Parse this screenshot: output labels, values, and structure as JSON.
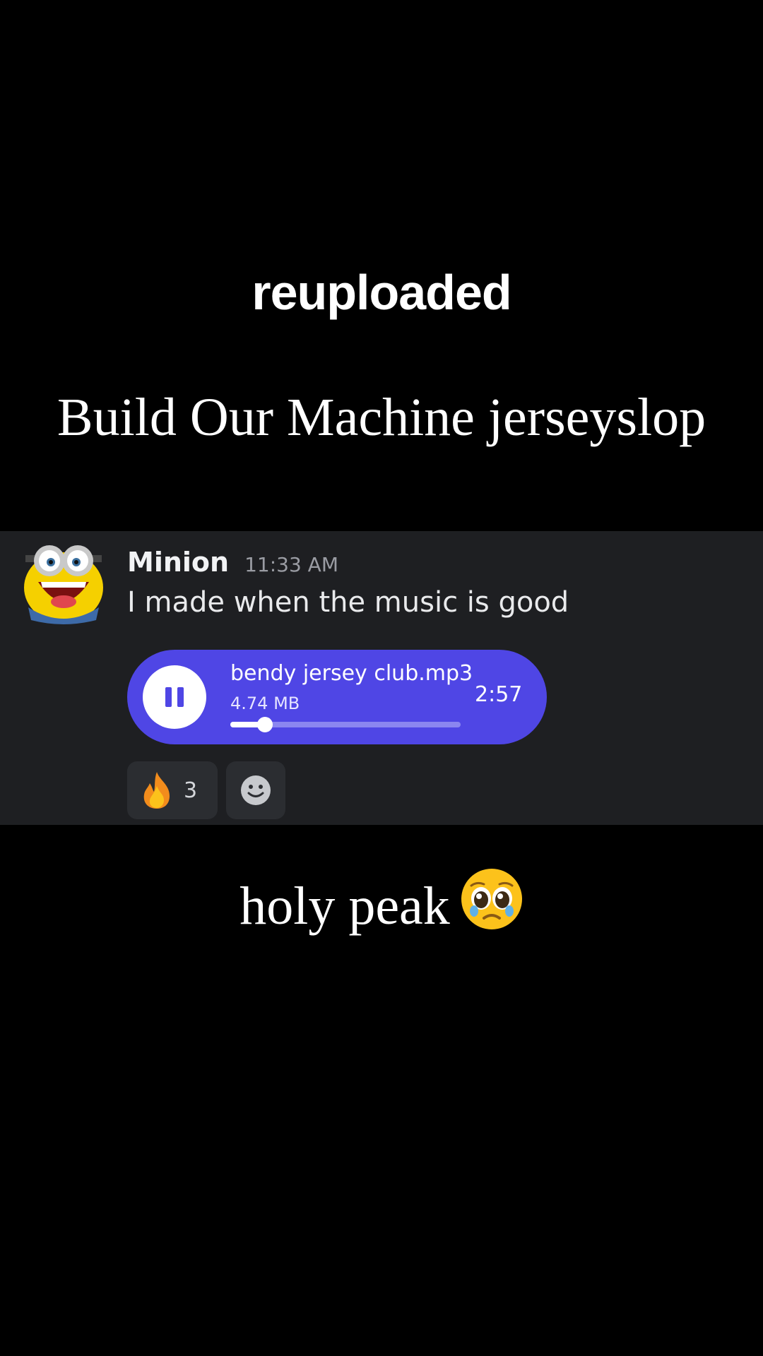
{
  "overlay": {
    "top_text": "reuploaded",
    "title": "Build Our Machine jerseyslop",
    "caption": "holy peak"
  },
  "message": {
    "username": "Minion",
    "timestamp": "11:33 AM",
    "text": "I made when the music is good",
    "avatar_icon": "minion-avatar-icon"
  },
  "audio": {
    "filename": "bendy jersey club.mp3",
    "size": "4.74 MB",
    "duration": "2:57",
    "progress": 0.15,
    "state_icon": "pause-icon",
    "accent": "#4f46e5"
  },
  "reactions": [
    {
      "emoji_icon": "fire-icon",
      "count": "3"
    }
  ],
  "add_reaction_icon": "smiley-add-reaction-icon",
  "caption_emoji_icon": "pleading-face-icon",
  "colors": {
    "background": "#000000",
    "panel": "#1e1f22",
    "reaction_bg": "#2b2d31"
  }
}
